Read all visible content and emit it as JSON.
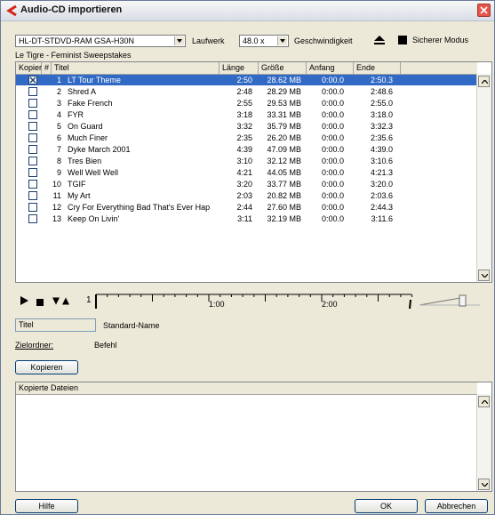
{
  "window": {
    "title": "Audio-CD importieren"
  },
  "drive": {
    "selected": "HL-DT-STDVD-RAM GSA-H30N",
    "label": "Laufwerk"
  },
  "speed": {
    "selected": "48.0 x",
    "label": "Geschwindigkeit"
  },
  "safe_mode": {
    "label": "Sicherer Modus"
  },
  "album": {
    "title": "Le Tigre - Feminist Sweepstakes"
  },
  "track_table": {
    "columns": [
      "Kopier",
      "#",
      "Titel",
      "Länge",
      "Größe",
      "Anfang",
      "Ende"
    ],
    "rows": [
      {
        "checked": true,
        "num": "1",
        "title": "LT Tour Theme",
        "length": "2:50",
        "size": "28.62 MB",
        "start": "0:00.0",
        "end": "2:50.3"
      },
      {
        "checked": false,
        "num": "2",
        "title": "Shred A",
        "length": "2:48",
        "size": "28.29 MB",
        "start": "0:00.0",
        "end": "2:48.6"
      },
      {
        "checked": false,
        "num": "3",
        "title": "Fake French",
        "length": "2:55",
        "size": "29.53 MB",
        "start": "0:00.0",
        "end": "2:55.0"
      },
      {
        "checked": false,
        "num": "4",
        "title": "FYR",
        "length": "3:18",
        "size": "33.31 MB",
        "start": "0:00.0",
        "end": "3:18.0"
      },
      {
        "checked": false,
        "num": "5",
        "title": "On Guard",
        "length": "3:32",
        "size": "35.79 MB",
        "start": "0:00.0",
        "end": "3:32.3"
      },
      {
        "checked": false,
        "num": "6",
        "title": "Much Finer",
        "length": "2:35",
        "size": "26.20 MB",
        "start": "0:00.0",
        "end": "2:35.6"
      },
      {
        "checked": false,
        "num": "7",
        "title": "Dyke March 2001",
        "length": "4:39",
        "size": "47.09 MB",
        "start": "0:00.0",
        "end": "4:39.0"
      },
      {
        "checked": false,
        "num": "8",
        "title": "Tres Bien",
        "length": "3:10",
        "size": "32.12 MB",
        "start": "0:00.0",
        "end": "3:10.6"
      },
      {
        "checked": false,
        "num": "9",
        "title": "Well Well Well",
        "length": "4:21",
        "size": "44.05 MB",
        "start": "0:00.0",
        "end": "4:21.3"
      },
      {
        "checked": false,
        "num": "10",
        "title": "TGIF",
        "length": "3:20",
        "size": "33.77 MB",
        "start": "0:00.0",
        "end": "3:20.0"
      },
      {
        "checked": false,
        "num": "11",
        "title": "My Art",
        "length": "2:03",
        "size": "20.82 MB",
        "start": "0:00.0",
        "end": "2:03.6"
      },
      {
        "checked": false,
        "num": "12",
        "title": "Cry For Everything Bad That's Ever Hap",
        "length": "2:44",
        "size": "27.60 MB",
        "start": "0:00.0",
        "end": "2:44.3"
      },
      {
        "checked": false,
        "num": "13",
        "title": "Keep On Livin'",
        "length": "3:11",
        "size": "32.19 MB",
        "start": "0:00.0",
        "end": "3:11.6"
      }
    ]
  },
  "transport": {
    "track_number": "1",
    "ruler_labels": [
      "1:00",
      "2:00"
    ]
  },
  "naming": {
    "field_value": "Titel",
    "scheme_label": "Standard-Name"
  },
  "destination": {
    "label": "Zielordner:",
    "value": "Befehl"
  },
  "buttons": {
    "copy": "Kopieren",
    "help": "Hilfe",
    "ok": "OK",
    "cancel": "Abbrechen"
  },
  "copied_files": {
    "header": "Kopierte Dateien"
  },
  "colors": {
    "selection": "#316ac5",
    "dialog_bg": "#ece9d8",
    "close_red": "#e8544a"
  },
  "icons": {
    "app": "cubase-logo-icon",
    "close": "close-icon",
    "eject": "eject-icon",
    "play": "play-icon",
    "stop": "stop-icon"
  }
}
